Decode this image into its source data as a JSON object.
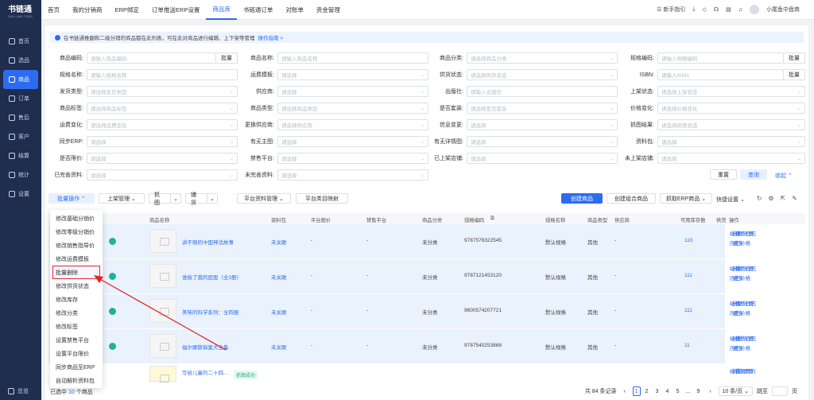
{
  "sidebar": {
    "logo_title": "书链通",
    "logo_sub": "SHU LIAN TONG",
    "items": [
      {
        "label": "首页",
        "icon": "home-icon"
      },
      {
        "label": "选品",
        "icon": "select-icon"
      },
      {
        "label": "商品",
        "icon": "goods-icon"
      },
      {
        "label": "订单",
        "icon": "order-icon"
      },
      {
        "label": "售后",
        "icon": "aftersale-icon"
      },
      {
        "label": "客户",
        "icon": "customer-icon"
      },
      {
        "label": "结算",
        "icon": "settle-icon"
      },
      {
        "label": "统计",
        "icon": "stats-icon"
      },
      {
        "label": "设置",
        "icon": "settings-icon"
      }
    ],
    "active_index": 2,
    "footer_label": "总览"
  },
  "topbar": {
    "tabs": [
      "首页",
      "我的分销商",
      "ERP绑定",
      "订单推送ERP设置",
      "商品库",
      "书链通订单",
      "对账单",
      "资金管理"
    ],
    "active_tab": 4,
    "guide": "新手指引",
    "user": "小尾鱼中盘商"
  },
  "notice": {
    "text": "在书链通推翻和二级分销的商品都在此列表，可在此对商品进行编辑、上下架等管理",
    "link": "操作指南 >"
  },
  "filters": {
    "rows": [
      [
        {
          "label": "商品编码:",
          "placeholder": "请输入商品编码",
          "batch": "批量"
        },
        {
          "label": "商品名称:",
          "placeholder": "请输入商品名称"
        },
        {
          "label": "商品分类:",
          "placeholder": "请选择商品分类",
          "select": true
        },
        {
          "label": "规格编码:",
          "placeholder": "请输入规格编码",
          "batch": "批量"
        }
      ],
      [
        {
          "label": "规格名称:",
          "placeholder": "请输入规格名称"
        },
        {
          "label": "运费模板:",
          "placeholder": "请选择",
          "select": true
        },
        {
          "label": "供货状态:",
          "placeholder": "请选择供货状态",
          "select": true
        },
        {
          "label": "ISBN:",
          "placeholder": "请输入ISBN",
          "batch": "批量"
        }
      ],
      [
        {
          "label": "发货类型:",
          "placeholder": "请选择发货类型",
          "select": true
        },
        {
          "label": "供应商:",
          "placeholder": "请选择",
          "select": true
        },
        {
          "label": "出版社:",
          "placeholder": "请输入出版社"
        },
        {
          "label": "上架状态:",
          "placeholder": "请选择上架状态",
          "select": true
        }
      ],
      [
        {
          "label": "商品标签:",
          "placeholder": "请选择商品标签",
          "select": true
        },
        {
          "label": "商品类型:",
          "placeholder": "请选择商品类型",
          "select": true
        },
        {
          "label": "是否套装:",
          "placeholder": "请选择是否套装",
          "select": true
        },
        {
          "label": "价格变化:",
          "placeholder": "请选择价格变化",
          "select": true
        }
      ],
      [
        {
          "label": "运费变化:",
          "placeholder": "请选择运费变化",
          "select": true
        },
        {
          "label": "更换供应商:",
          "placeholder": "请选择供应商",
          "select": true
        },
        {
          "label": "信息变更:",
          "placeholder": "请选择",
          "select": true
        },
        {
          "label": "抓图结果:",
          "placeholder": "请选择抓图状态",
          "select": true
        }
      ],
      [
        {
          "label": "同步ERP:",
          "placeholder": "请选择",
          "select": true
        },
        {
          "label": "有无主图:",
          "placeholder": "请选择",
          "select": true
        },
        {
          "label": "有无详情图:",
          "placeholder": "请选择",
          "select": true
        },
        {
          "label": "资料包:",
          "placeholder": "请选择",
          "select": true
        }
      ],
      [
        {
          "label": "是否限价:",
          "placeholder": "请选择",
          "select": true
        },
        {
          "label": "禁售平台:",
          "placeholder": "请选择",
          "select": true
        },
        {
          "label": "已上架店铺:",
          "placeholder": "请选择",
          "select": true
        },
        {
          "label": "未上架店铺:",
          "placeholder": "请选择",
          "select": true
        }
      ],
      [
        {
          "label": "已完善资料:",
          "placeholder": "请选择",
          "select": true
        },
        {
          "label": "未完善资料:",
          "placeholder": "请选择",
          "select": true
        }
      ]
    ],
    "reset": "重置",
    "query": "查询",
    "collapse": "收起"
  },
  "toolbar": {
    "batch": "批量操作",
    "listing": "上架管理",
    "grab": "抓 图",
    "supply": "铺 货",
    "platform": "平台资料管理",
    "category_map": "平台类目映射",
    "create": "创建商品",
    "create_combo": "创建组合商品",
    "grab_erp": "抓取ERP商品",
    "quick_set": "快捷设置"
  },
  "dropdown": [
    "修改基础分销价",
    "修改零级分销价",
    "修改销售指导价",
    "修改运费模板",
    "批量删除",
    "修改供货状态",
    "修改库存",
    "修改分类",
    "修改标签",
    "设置禁售平台",
    "设置平台限价",
    "同步商品至ERP",
    "自动解析资料包"
  ],
  "dropdown_selected": 4,
  "table": {
    "headers": [
      "商品名称",
      "资料包",
      "平台限价",
      "禁售平台",
      "商品分类",
      "规格编码",
      "规格名称",
      "商品类型",
      "供应商",
      "可用库存数",
      "供货",
      "操作"
    ],
    "rows": [
      {
        "name": "讲不够的中国神话故事",
        "pack": "未关联",
        "limit": "-",
        "ban": "-",
        "cat": "未分类",
        "code": "9787576322545",
        "spec": "默认规格",
        "type": "其他",
        "supplier": "-",
        "stock": "110"
      },
      {
        "name": "谁偷了我的屁股（全3册）",
        "pack": "未关联",
        "limit": "-",
        "ban": "-",
        "cat": "未分类",
        "code": "9787121453120",
        "spec": "默认规格",
        "type": "其他",
        "supplier": "-",
        "stock": "111"
      },
      {
        "name": "美味的科学系列：全四册",
        "pack": "未关联",
        "limit": "-",
        "ban": "-",
        "cat": "未分类",
        "code": "9600574207721",
        "spec": "默认规格",
        "type": "其他",
        "supplier": "-",
        "stock": "111"
      },
      {
        "name": "福尔摩斯探案大全集",
        "pack": "未关联",
        "limit": "-",
        "ban": "-",
        "cat": "未分类",
        "code": "9787540253868",
        "spec": "默认规格",
        "type": "其他",
        "supplier": "-",
        "stock": "11"
      }
    ],
    "partial_row": {
      "name": "写给儿童的二十四...",
      "tag": "抓图成功"
    },
    "ops_line1": [
      "编辑",
      "分销详情",
      "操作日志"
    ],
    "ops_line2": [
      "历史价格",
      "更多"
    ],
    "ops_last": [
      "编辑",
      "分销详情",
      "使用图片"
    ]
  },
  "footer": {
    "selected": "已选中",
    "count": "10",
    "unit": "个商品",
    "total": "共 84 条记录",
    "pages": [
      "1",
      "2",
      "3",
      "4",
      "5",
      "...",
      "9"
    ],
    "page_size": "10 条/页",
    "goto": "跳至",
    "page_unit": "页"
  }
}
